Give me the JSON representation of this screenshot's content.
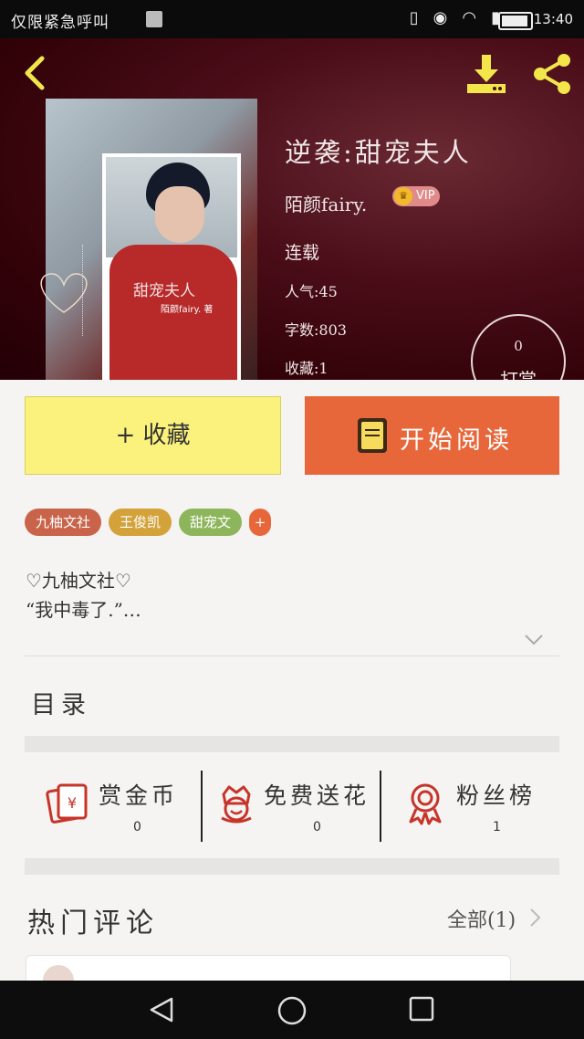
{
  "status_bar": {
    "carrier": "仅限紧急呼叫",
    "time": "13:40",
    "icons": [
      "vibrate-icon",
      "eye-icon",
      "wifi-icon",
      "sim-icon",
      "battery-icon"
    ]
  },
  "book": {
    "title": "逆袭:甜宠夫人",
    "author": "陌颜fairy.",
    "vip_label": "VIP",
    "status": "连载",
    "popularity": "人气:45",
    "word_count": "字数:803",
    "favorites": "收藏:1",
    "cover_title": "甜宠夫人",
    "cover_author": "陌颜fairy. 著"
  },
  "tip": {
    "count": "0",
    "label": "打赏"
  },
  "actions": {
    "favorite": "+ 收藏",
    "read": "开始阅读"
  },
  "tags": [
    {
      "label": "九柚文社",
      "color": "#c9644a"
    },
    {
      "label": "王俊凯",
      "color": "#d4a23b"
    },
    {
      "label": "甜宠文",
      "color": "#8db65c"
    },
    {
      "label": "+",
      "color": "#e8673a"
    }
  ],
  "description": {
    "line1": "♡九柚文社♡",
    "line2": "“我中毒了.”…"
  },
  "toc_label": "目录",
  "stats": [
    {
      "label": "赏金币",
      "value": "0",
      "icon": "red-envelope-icon"
    },
    {
      "label": "免费送花",
      "value": "0",
      "icon": "flower-icon"
    },
    {
      "label": "粉丝榜",
      "value": "1",
      "icon": "medal-icon"
    }
  ],
  "comments": {
    "heading": "热门评论",
    "all_label": "全部(1)"
  },
  "colors": {
    "accent": "#e8673a",
    "favorite_button": "#faf27c",
    "icon_red": "#c7342a",
    "header_bg": "#4a0d18"
  }
}
